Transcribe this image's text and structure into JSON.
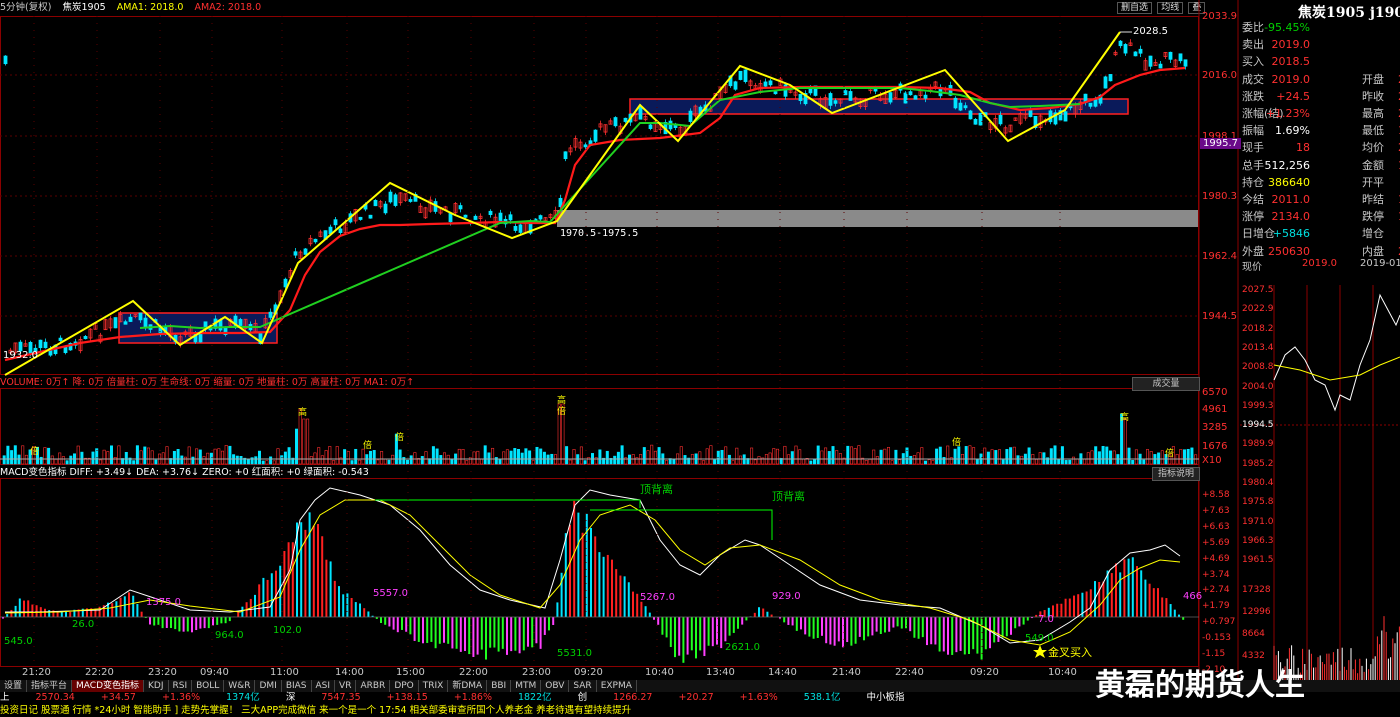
{
  "header": {
    "period": "5分钟(复权)",
    "symbol": "焦炭1905",
    "ama1": "AMA1: 2018.0",
    "ama2": "AMA2: 2018.0",
    "buttons": [
      "删自选",
      "均线",
      "叠"
    ]
  },
  "quote": {
    "title": "焦炭1905 j1905",
    "rows": [
      {
        "l": "委比",
        "v": "-95.45%",
        "c": "green"
      },
      {
        "l": "卖出",
        "v": "2019.0",
        "c": "red"
      },
      {
        "l": "买入",
        "v": "2018.5",
        "c": "red"
      },
      {
        "l": "成交",
        "v": "2019.0",
        "c": "red",
        "l2": "开盘",
        "v2": "20"
      },
      {
        "l": "涨跌",
        "v": "+24.5",
        "c": "red",
        "l2": "昨收",
        "v2": "20"
      },
      {
        "l": "涨幅(结)",
        "v": "+1.23%",
        "c": "red",
        "l2": "最高",
        "v2": "20"
      },
      {
        "l": "振幅",
        "v": "1.69%",
        "c": "white",
        "l2": "最低",
        "v2": "19"
      },
      {
        "l": "现手",
        "v": "18",
        "c": "red",
        "l2": "均价",
        "v2": "20"
      },
      {
        "l": "总手",
        "v": "512,256",
        "c": "white",
        "l2": "金额",
        "v2": "10"
      },
      {
        "l": "持仓",
        "v": "386640",
        "c": "yellow",
        "l2": "开平",
        "v2": ""
      },
      {
        "l": "今结",
        "v": "2011.0",
        "c": "red",
        "l2": "昨结",
        "v2": "19"
      },
      {
        "l": "涨停",
        "v": "2134.0",
        "c": "red",
        "l2": "跌停",
        "v2": "18"
      },
      {
        "l": "日增仓",
        "v": "+5846",
        "c": "cyan",
        "l2": "增仓",
        "v2": ""
      },
      {
        "l": "外盘",
        "v": "250630",
        "c": "red",
        "l2": "内盘",
        "v2": "26"
      }
    ],
    "now_label": "现价",
    "now_price": "2019.0",
    "now_date": "2019-01-",
    "mini_axis": [
      "2027.5",
      "2022.9",
      "2018.2",
      "2013.4",
      "2008.8",
      "2004.0",
      "1999.3",
      "1994.5",
      "1989.9",
      "1985.2",
      "1980.4",
      "1975.8",
      "1971.0",
      "1966.3",
      "1961.5",
      "17328",
      "12996",
      "8664",
      "4332"
    ]
  },
  "price_axis": [
    "2033.9",
    "2016.0",
    "1998.1",
    "1980.3",
    "1962.4",
    "1944.5"
  ],
  "price_tag": "1995.7",
  "annotations": {
    "high": "2028.5",
    "low": "1932.0",
    "gap": "1970.5-1975.5"
  },
  "volume_bar": {
    "text": "VOLUME: 0万↑  降: 0万  倍量柱: 0万  生命线: 0万  缩量: 0万  地量柱: 0万  高量柱: 0万  MA1: 0万↑",
    "button": "成交量",
    "axis": [
      "6570",
      "4961",
      "3285",
      "1676",
      "X10"
    ],
    "high_tag": "高",
    "double_tag": "倍"
  },
  "macd_bar": {
    "text": "MACD变色指标  DIFF: +3.49↓  DEA: +3.76↓  ZERO: +0  红面积: +0  绿面积: -0.543",
    "button": "指标说明",
    "axis": [
      "+8.58",
      "+7.63",
      "+6.63",
      "+5.69",
      "+4.69",
      "+3.74",
      "+2.74",
      "+1.79",
      "+0.797",
      "-0.153",
      "-1.15",
      "-2.10"
    ],
    "labels": [
      {
        "t": "545.0",
        "c": "green"
      },
      {
        "t": "26.0",
        "c": "green"
      },
      {
        "t": "1375.0",
        "c": "mag"
      },
      {
        "t": "964.0",
        "c": "green"
      },
      {
        "t": "102.0",
        "c": "green"
      },
      {
        "t": "5557.0",
        "c": "mag"
      },
      {
        "t": "5531.0",
        "c": "green"
      },
      {
        "t": "5267.0",
        "c": "mag"
      },
      {
        "t": "2621.0",
        "c": "green"
      },
      {
        "t": "929.0",
        "c": "mag"
      },
      {
        "t": "7.0",
        "c": "mag"
      },
      {
        "t": "549.0",
        "c": "green"
      },
      {
        "t": "466",
        "c": "mag"
      }
    ],
    "divergence": "顶背离",
    "gold_cross": "金叉买入"
  },
  "time_axis": [
    "21:20",
    "22:20",
    "23:20",
    "09:40",
    "11:00",
    "14:00",
    "15:00",
    "22:00",
    "23:00",
    "09:20",
    "10:40",
    "13:40",
    "14:40",
    "21:40",
    "22:40",
    "09:20",
    "10:40"
  ],
  "tabs": [
    "设置",
    "指标平台",
    "MACD变色指标",
    "KDJ",
    "RSI",
    "BOLL",
    "W&R",
    "DMI",
    "BIAS",
    "ASI",
    "VR",
    "ARBR",
    "DPO",
    "TRIX",
    "新DMA",
    "BBI",
    "MTM",
    "OBV",
    "SAR",
    "EXPMA"
  ],
  "status": [
    {
      "t": "上",
      "c": "white"
    },
    {
      "t": "2570.34",
      "c": "red"
    },
    {
      "t": "+34.57",
      "c": "red"
    },
    {
      "t": "+1.36%",
      "c": "red"
    },
    {
      "t": "1374亿",
      "c": "cyan"
    },
    {
      "t": "深",
      "c": "white"
    },
    {
      "t": "7547.35",
      "c": "red"
    },
    {
      "t": "+138.15",
      "c": "red"
    },
    {
      "t": "+1.86%",
      "c": "red"
    },
    {
      "t": "1822亿",
      "c": "cyan"
    },
    {
      "t": "创",
      "c": "white"
    },
    {
      "t": "1266.27",
      "c": "red"
    },
    {
      "t": "+20.27",
      "c": "red"
    },
    {
      "t": "+1.63%",
      "c": "red"
    },
    {
      "t": "538.1亿",
      "c": "cyan"
    },
    {
      "t": "中小板指",
      "c": "white"
    }
  ],
  "news": "投资日记  股票通  行情  *24小时  智能助手  ] 走势先掌握！ 三大APP完成微信  来一个是一个     17:54 相关部委审查所国个人养老金 养老待遇有望持续提升",
  "watermark": "黄磊的期货人生"
}
